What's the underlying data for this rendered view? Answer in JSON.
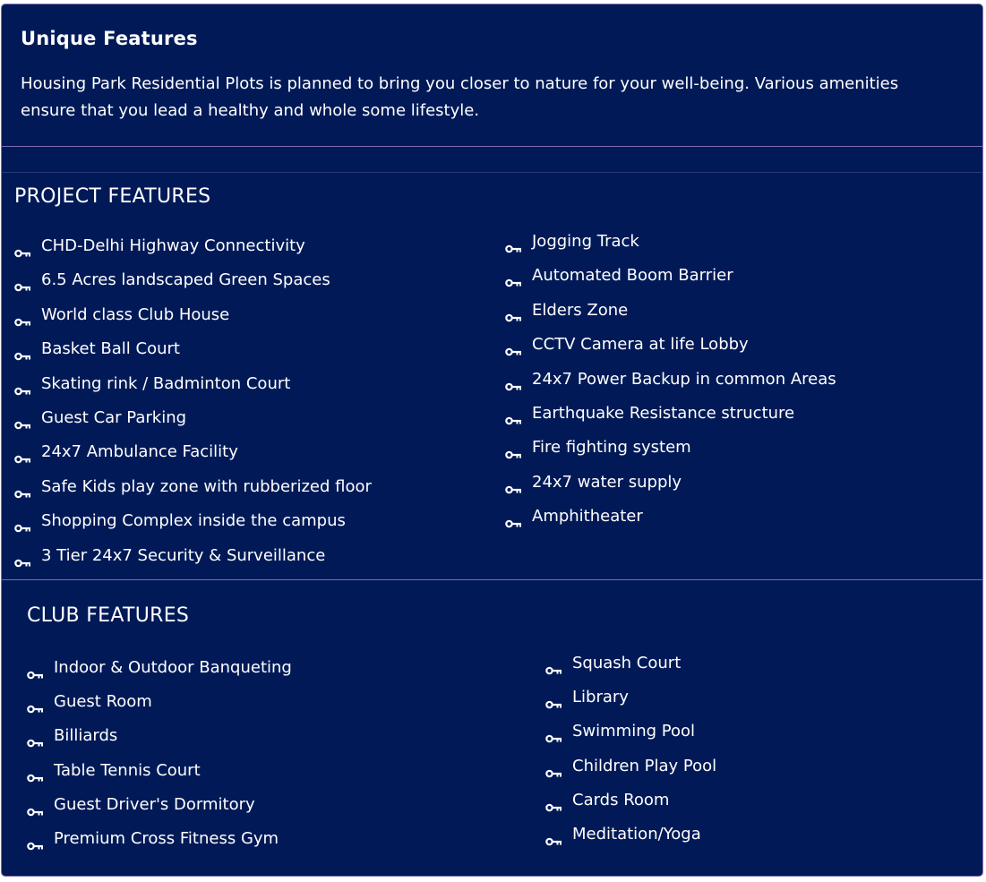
{
  "intro": {
    "title": "Unique  Features",
    "description": "Housing Park Residential Plots is planned to bring you closer to nature for your well-being. Various amenities ensure that you lead a healthy and whole some lifestyle."
  },
  "project_features": {
    "title": "PROJECT FEATURES",
    "left": [
      "CHD-Delhi Highway Connectivity",
      "6.5 Acres landscaped Green Spaces",
      "World class Club House",
      "Basket Ball Court",
      "Skating rink / Badminton Court",
      "Guest Car Parking",
      "24x7 Ambulance Facility",
      "Safe Kids play zone with rubberized floor",
      "Shopping Complex inside the campus",
      "3 Tier 24x7 Security & Surveillance"
    ],
    "right": [
      "Jogging Track",
      "Automated Boom Barrier",
      "Elders Zone",
      "CCTV Camera at life Lobby",
      "24x7 Power Backup in common Areas",
      "Earthquake Resistance structure",
      "Fire fighting system",
      "24x7 water supply",
      "Amphitheater"
    ]
  },
  "club_features": {
    "title": "CLUB FEATURES",
    "left": [
      "Indoor & Outdoor Banqueting",
      "Guest Room",
      "Billiards",
      "Table Tennis Court",
      "Guest Driver's Dormitory",
      "Premium Cross Fitness Gym"
    ],
    "right": [
      "Squash Court",
      "Library",
      "Swimming Pool",
      "Children Play Pool",
      "Cards Room",
      "Meditation/Yoga"
    ]
  },
  "colors": {
    "background": "#011a57",
    "border": "#7e6bb0",
    "text": "#ffffff"
  },
  "icons": {
    "bullet": "key-icon"
  }
}
